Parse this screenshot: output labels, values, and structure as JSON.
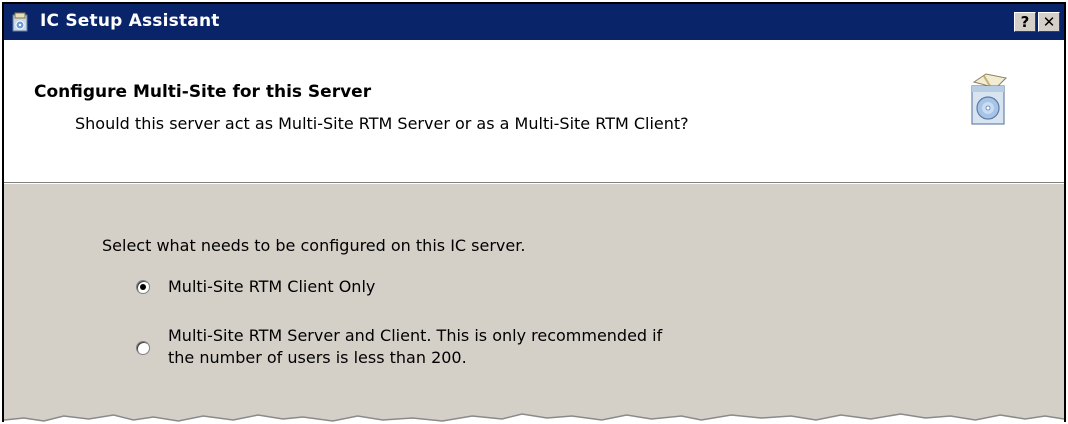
{
  "window": {
    "title": "IC Setup Assistant",
    "help_label": "?",
    "close_label": "✕"
  },
  "header": {
    "title": "Configure Multi-Site for this Server",
    "subtitle": "Should this server act as Multi-Site RTM Server or as a Multi-Site RTM Client?"
  },
  "body": {
    "prompt": "Select what needs to be configured on this IC server.",
    "options": [
      {
        "label": "Multi-Site RTM Client Only",
        "selected": true
      },
      {
        "label_line1": "Multi-Site RTM Server and Client. This is only recommended if",
        "label_line2": "the number of users is less than 200.",
        "selected": false
      }
    ]
  },
  "icons": {
    "title_icon": "setup-icon",
    "header_icon": "install-disc-icon"
  }
}
